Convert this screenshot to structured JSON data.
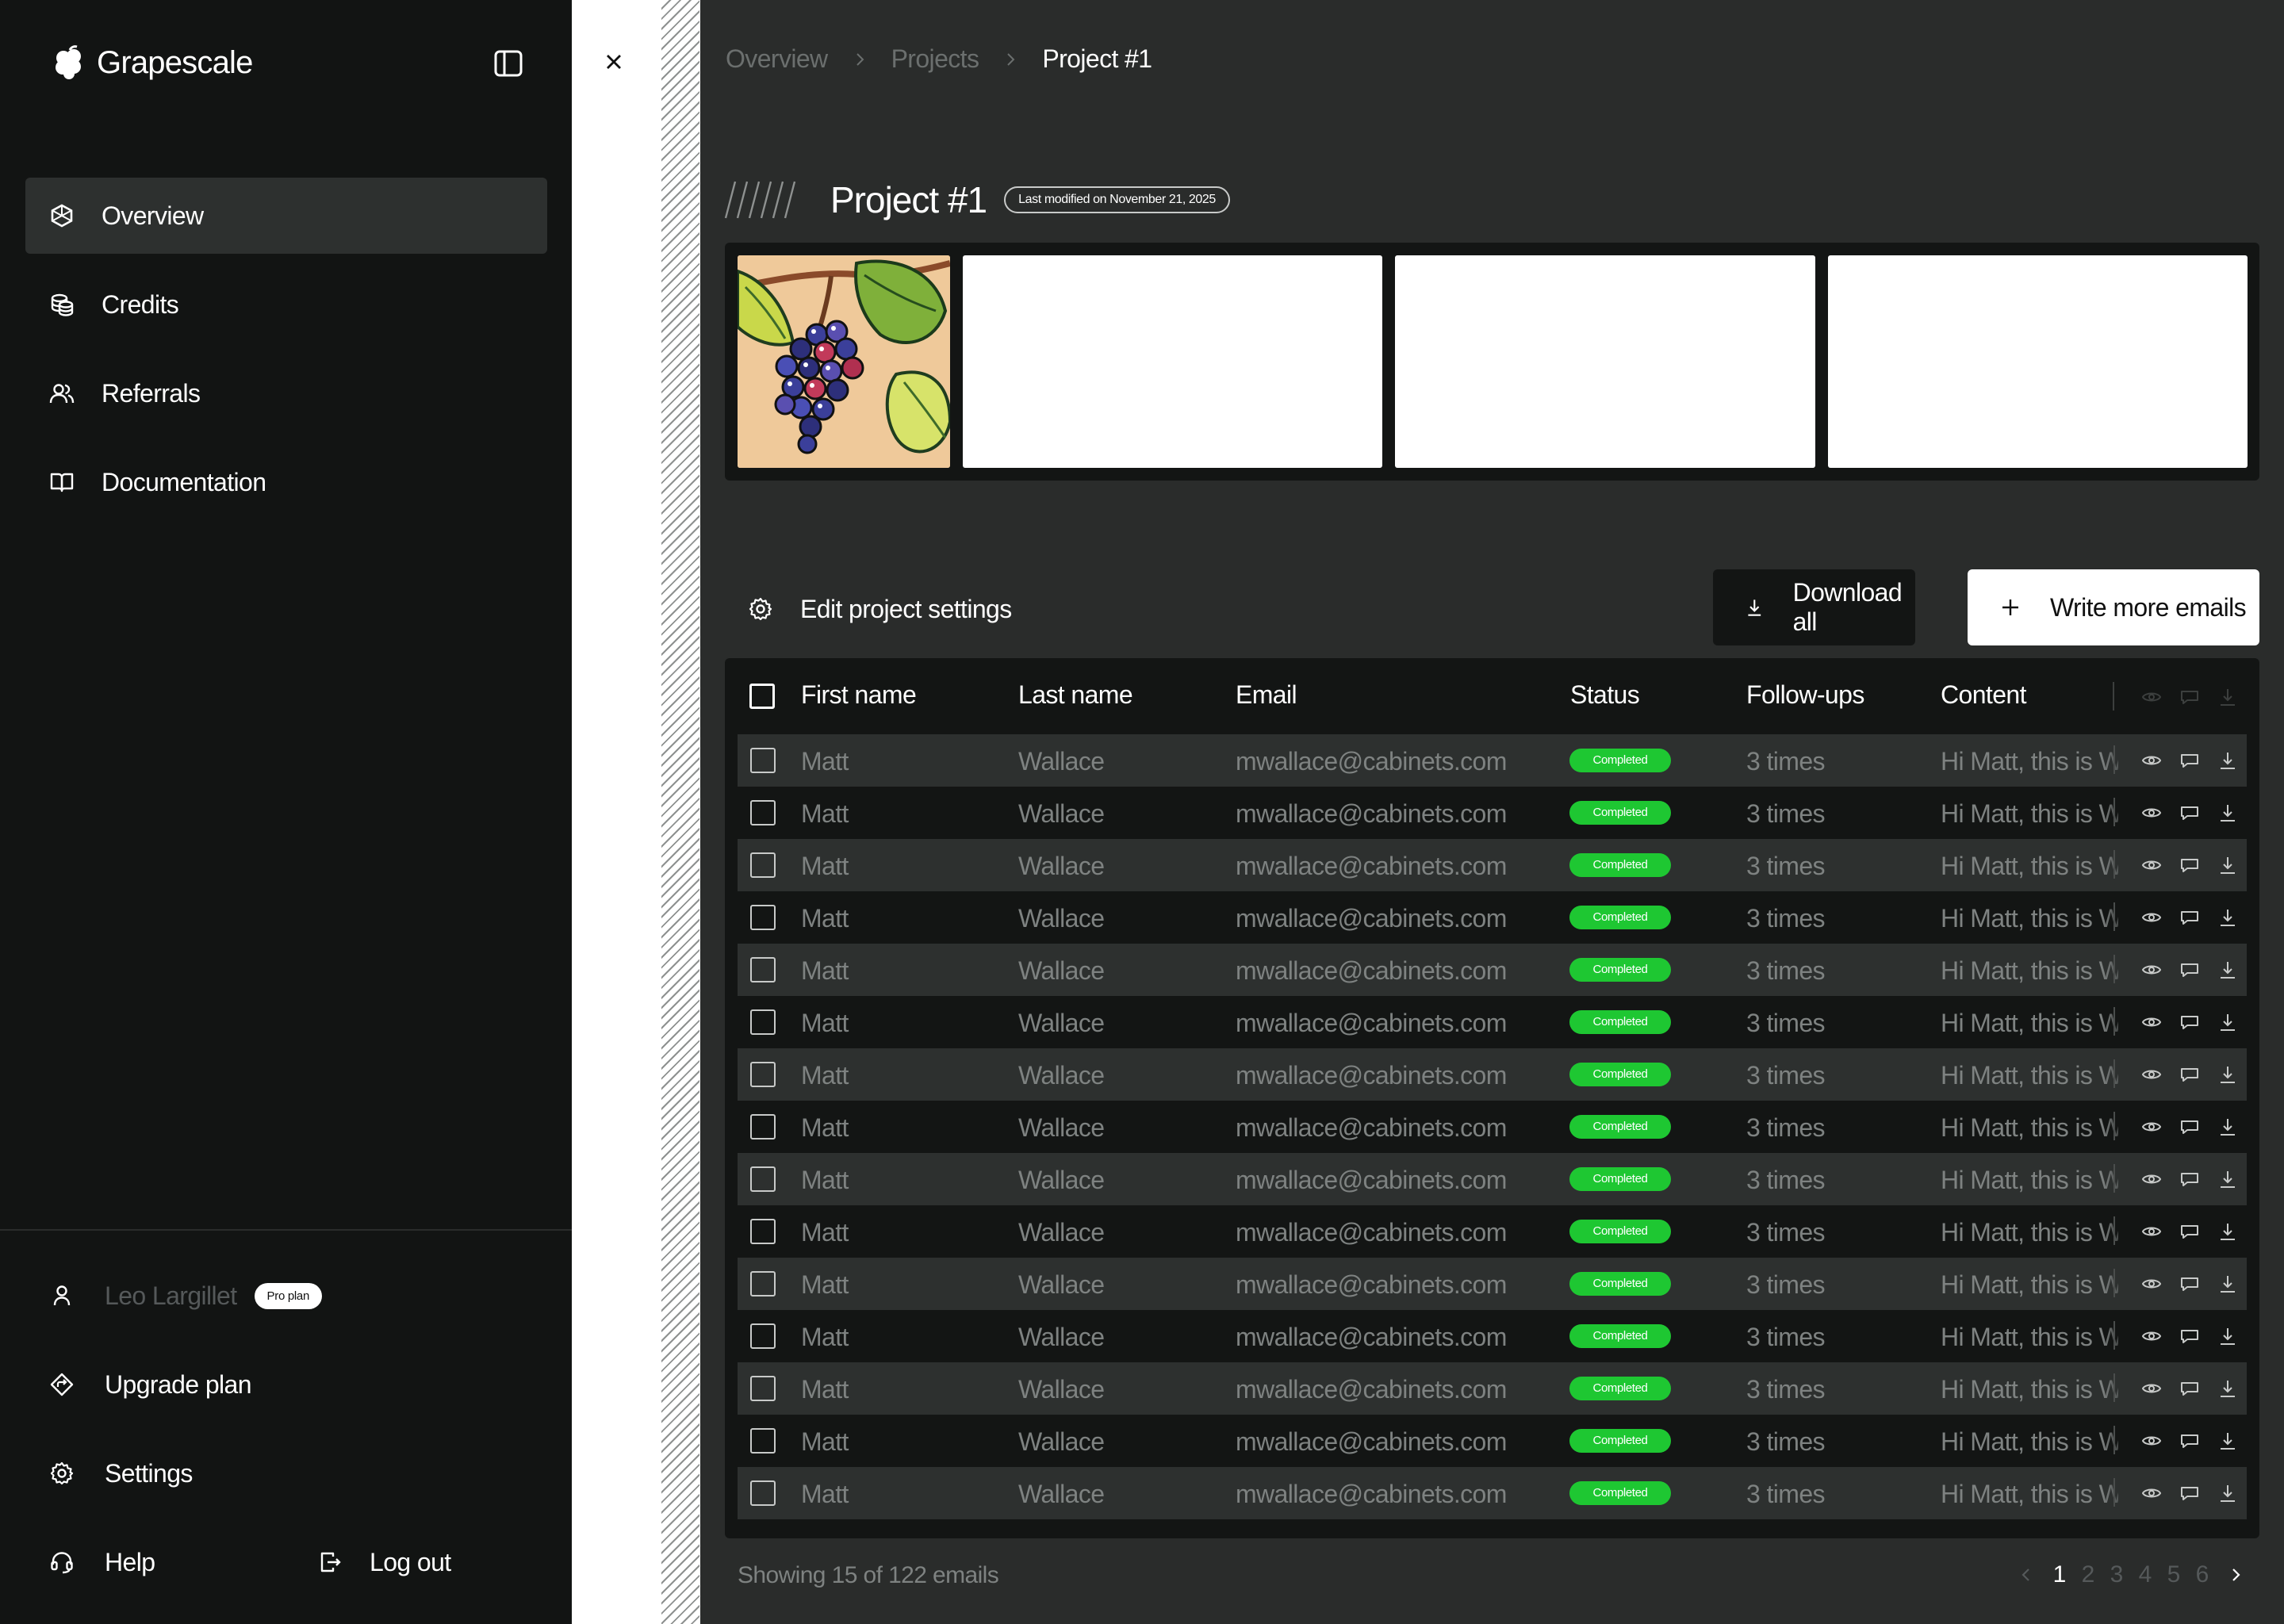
{
  "app": {
    "name": "Grapescale"
  },
  "sidebar": {
    "nav": [
      {
        "label": "Overview",
        "icon": "hexagon-icon",
        "active": true
      },
      {
        "label": "Credits",
        "icon": "coins-icon",
        "active": false
      },
      {
        "label": "Referrals",
        "icon": "users-icon",
        "active": false
      },
      {
        "label": "Documentation",
        "icon": "book-icon",
        "active": false
      }
    ],
    "user": {
      "name": "Leo Largillet",
      "plan": "Pro plan"
    },
    "upgrade_label": "Upgrade plan",
    "settings_label": "Settings",
    "help_label": "Help",
    "logout_label": "Log out"
  },
  "breadcrumb": [
    "Overview",
    "Projects",
    "Project #1"
  ],
  "project": {
    "title": "Project #1",
    "modified": "Last modified on November 21, 2025"
  },
  "actions": {
    "edit_settings": "Edit project settings",
    "download_all": "Download all",
    "write_more": "Write more emails"
  },
  "table": {
    "columns": [
      "First name",
      "Last name",
      "Email",
      "Status",
      "Follow-ups",
      "Content"
    ],
    "rows": [
      {
        "first": "Matt",
        "last": "Wallace",
        "email": "mwallace@cabinets.com",
        "status": "Completed",
        "followups": "3 times",
        "content": "Hi Matt, this is Walter"
      },
      {
        "first": "Matt",
        "last": "Wallace",
        "email": "mwallace@cabinets.com",
        "status": "Completed",
        "followups": "3 times",
        "content": "Hi Matt, this is Walter"
      },
      {
        "first": "Matt",
        "last": "Wallace",
        "email": "mwallace@cabinets.com",
        "status": "Completed",
        "followups": "3 times",
        "content": "Hi Matt, this is Walter"
      },
      {
        "first": "Matt",
        "last": "Wallace",
        "email": "mwallace@cabinets.com",
        "status": "Completed",
        "followups": "3 times",
        "content": "Hi Matt, this is Walter"
      },
      {
        "first": "Matt",
        "last": "Wallace",
        "email": "mwallace@cabinets.com",
        "status": "Completed",
        "followups": "3 times",
        "content": "Hi Matt, this is Walter"
      },
      {
        "first": "Matt",
        "last": "Wallace",
        "email": "mwallace@cabinets.com",
        "status": "Completed",
        "followups": "3 times",
        "content": "Hi Matt, this is Walter"
      },
      {
        "first": "Matt",
        "last": "Wallace",
        "email": "mwallace@cabinets.com",
        "status": "Completed",
        "followups": "3 times",
        "content": "Hi Matt, this is Walter"
      },
      {
        "first": "Matt",
        "last": "Wallace",
        "email": "mwallace@cabinets.com",
        "status": "Completed",
        "followups": "3 times",
        "content": "Hi Matt, this is Walter"
      },
      {
        "first": "Matt",
        "last": "Wallace",
        "email": "mwallace@cabinets.com",
        "status": "Completed",
        "followups": "3 times",
        "content": "Hi Matt, this is Walter"
      },
      {
        "first": "Matt",
        "last": "Wallace",
        "email": "mwallace@cabinets.com",
        "status": "Completed",
        "followups": "3 times",
        "content": "Hi Matt, this is Walter"
      },
      {
        "first": "Matt",
        "last": "Wallace",
        "email": "mwallace@cabinets.com",
        "status": "Completed",
        "followups": "3 times",
        "content": "Hi Matt, this is Walter"
      },
      {
        "first": "Matt",
        "last": "Wallace",
        "email": "mwallace@cabinets.com",
        "status": "Completed",
        "followups": "3 times",
        "content": "Hi Matt, this is Walter"
      },
      {
        "first": "Matt",
        "last": "Wallace",
        "email": "mwallace@cabinets.com",
        "status": "Completed",
        "followups": "3 times",
        "content": "Hi Matt, this is Walter"
      },
      {
        "first": "Matt",
        "last": "Wallace",
        "email": "mwallace@cabinets.com",
        "status": "Completed",
        "followups": "3 times",
        "content": "Hi Matt, this is Walter"
      },
      {
        "first": "Matt",
        "last": "Wallace",
        "email": "mwallace@cabinets.com",
        "status": "Completed",
        "followups": "3 times",
        "content": "Hi Matt, this is Walter"
      }
    ]
  },
  "footer": {
    "showing": "Showing 15 of 122 emails",
    "pages": [
      "1",
      "2",
      "3",
      "4",
      "5",
      "6"
    ],
    "current_page": "1"
  },
  "colors": {
    "status_completed": "#1ec732",
    "sidebar_bg": "#121413",
    "main_bg": "#2a2c2b"
  }
}
